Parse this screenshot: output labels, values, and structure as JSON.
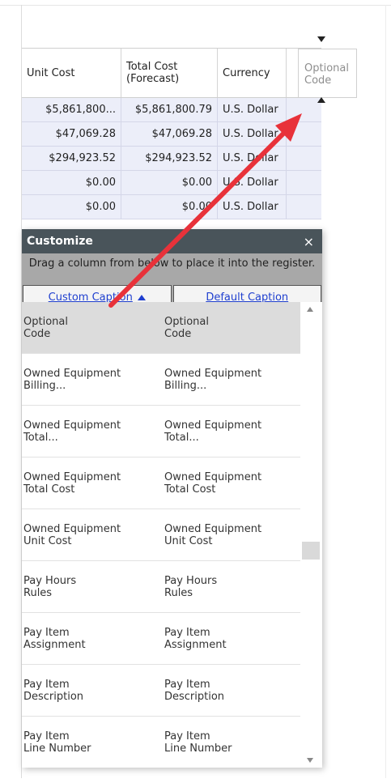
{
  "grid": {
    "headers": {
      "unit_cost": "Unit Cost",
      "total_cost": "Total Cost\n(Forecast)",
      "currency": "Currency",
      "optional_code": "Optional\nCode"
    },
    "rows": [
      {
        "unit_cost": "$5,861,800...",
        "total_cost": "$5,861,800.79",
        "currency": "U.S. Dollar"
      },
      {
        "unit_cost": "$47,069.28",
        "total_cost": "$47,069.28",
        "currency": "U.S. Dollar"
      },
      {
        "unit_cost": "$294,923.52",
        "total_cost": "$294,923.52",
        "currency": "U.S. Dollar"
      },
      {
        "unit_cost": "$0.00",
        "total_cost": "$0.00",
        "currency": "U.S. Dollar"
      },
      {
        "unit_cost": "$0.00",
        "total_cost": "$0.00",
        "currency": "U.S. Dollar"
      }
    ]
  },
  "customize": {
    "title": "Customize",
    "close": "×",
    "instructions": "Drag a column from below to place it into the register.",
    "sort_custom": "Custom Caption",
    "sort_default": "Default Caption",
    "items": [
      {
        "custom": "Optional\nCode",
        "default": "Optional\nCode"
      },
      {
        "custom": "Owned Equipment\nBilling...",
        "default": "Owned Equipment\nBilling..."
      },
      {
        "custom": "Owned Equipment\nTotal...",
        "default": "Owned Equipment\nTotal..."
      },
      {
        "custom": "Owned Equipment\nTotal Cost",
        "default": "Owned Equipment\nTotal Cost"
      },
      {
        "custom": "Owned Equipment\nUnit Cost",
        "default": "Owned Equipment\nUnit Cost"
      },
      {
        "custom": "Pay Hours\nRules",
        "default": "Pay Hours\nRules"
      },
      {
        "custom": "Pay Item\nAssignment",
        "default": "Pay Item\nAssignment"
      },
      {
        "custom": "Pay Item\nDescription",
        "default": "Pay Item\nDescription"
      },
      {
        "custom": "Pay Item\nLine Number",
        "default": "Pay Item\nLine Number"
      }
    ]
  },
  "colors": {
    "panel_header": "#49545a",
    "row_fill": "#eceef9",
    "link": "#1f3fcf",
    "annotation": "#e8323a"
  }
}
